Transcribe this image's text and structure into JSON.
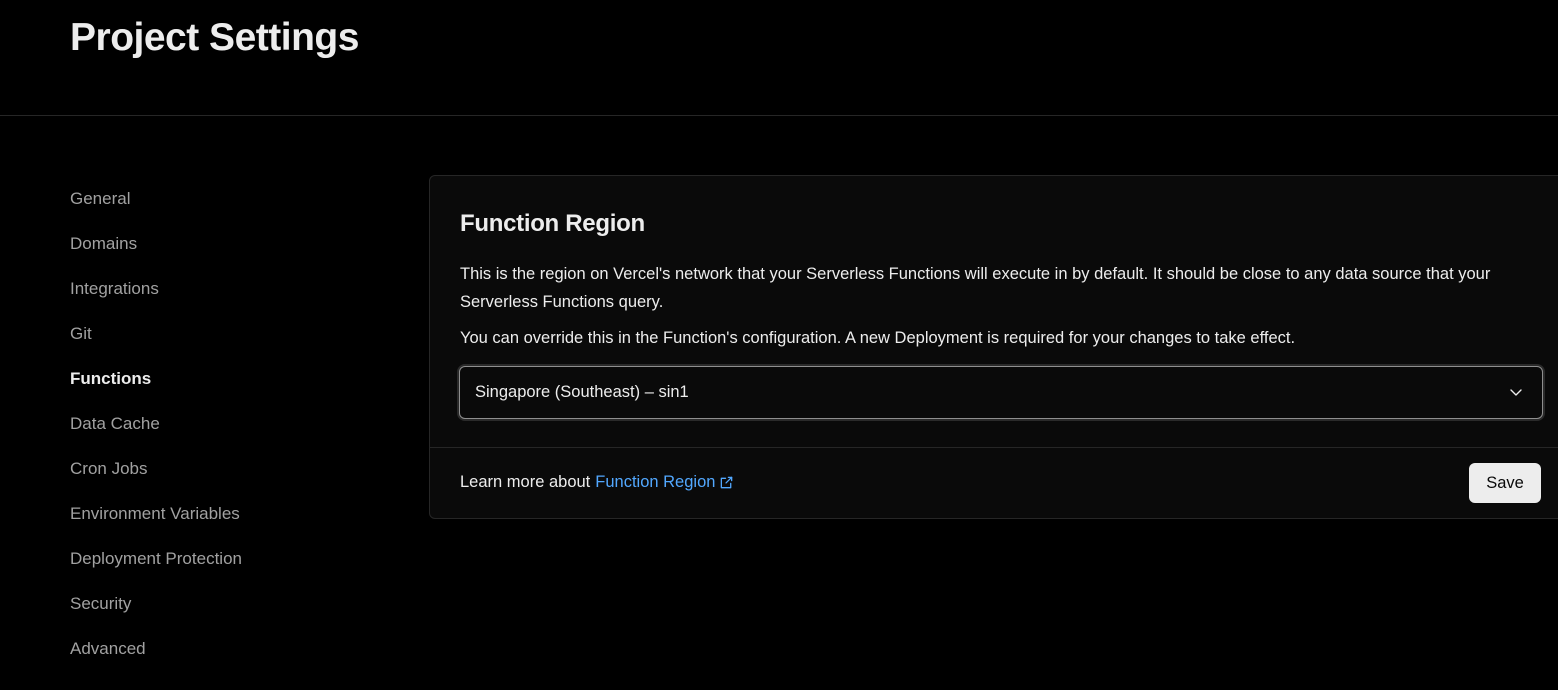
{
  "header": {
    "title": "Project Settings"
  },
  "sidebar": {
    "items": [
      {
        "label": "General",
        "active": false
      },
      {
        "label": "Domains",
        "active": false
      },
      {
        "label": "Integrations",
        "active": false
      },
      {
        "label": "Git",
        "active": false
      },
      {
        "label": "Functions",
        "active": true
      },
      {
        "label": "Data Cache",
        "active": false
      },
      {
        "label": "Cron Jobs",
        "active": false
      },
      {
        "label": "Environment Variables",
        "active": false
      },
      {
        "label": "Deployment Protection",
        "active": false
      },
      {
        "label": "Security",
        "active": false
      },
      {
        "label": "Advanced",
        "active": false
      }
    ]
  },
  "card": {
    "title": "Function Region",
    "description": "This is the region on Vercel's network that your Serverless Functions will execute in by default. It should be close to any data source that your Serverless Functions query.",
    "description2": "You can override this in the Function's configuration. A new Deployment is required for your changes to take effect.",
    "region_select": {
      "value": "Singapore (Southeast) – sin1",
      "icon": "chevron-down-icon"
    },
    "footer": {
      "learn_more_prefix": "Learn more about",
      "learn_more_link": "Function Region",
      "link_icon": "external-link-icon",
      "save_label": "Save"
    }
  },
  "colors": {
    "background": "#000000",
    "card_background": "#0a0a0a",
    "border": "#262626",
    "text_primary": "#ededed",
    "text_secondary": "#a1a1a1",
    "link": "#52a8ff",
    "button_background": "#ededed"
  }
}
